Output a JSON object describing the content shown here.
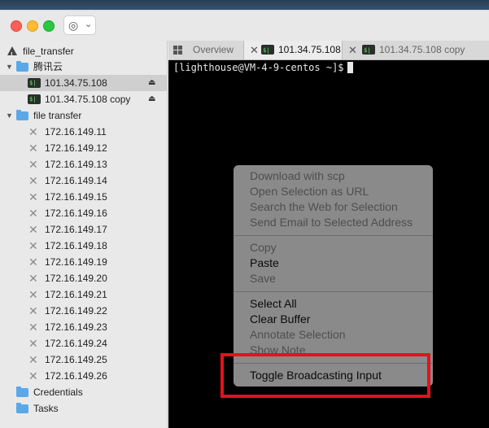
{
  "window": {
    "title_button_glyph": "◎",
    "title_button_chevron": "⌄"
  },
  "sidebar": {
    "root_label": "file_transfer",
    "groups": [
      {
        "label": "腾讯云",
        "hosts": [
          {
            "label": "101.34.75.108",
            "selected": true
          },
          {
            "label": "101.34.75.108 copy",
            "selected": false
          }
        ]
      },
      {
        "label": "file transfer",
        "hosts": [
          {
            "label": "172.16.149.11"
          },
          {
            "label": "172.16.149.12"
          },
          {
            "label": "172.16.149.13"
          },
          {
            "label": "172.16.149.14"
          },
          {
            "label": "172.16.149.15"
          },
          {
            "label": "172.16.149.16"
          },
          {
            "label": "172.16.149.17"
          },
          {
            "label": "172.16.149.18"
          },
          {
            "label": "172.16.149.19"
          },
          {
            "label": "172.16.149.20"
          },
          {
            "label": "172.16.149.21"
          },
          {
            "label": "172.16.149.22"
          },
          {
            "label": "172.16.149.23"
          },
          {
            "label": "172.16.149.24"
          },
          {
            "label": "172.16.149.25"
          },
          {
            "label": "172.16.149.26"
          }
        ]
      }
    ],
    "credentials_label": "Credentials",
    "tasks_label": "Tasks"
  },
  "tabs": [
    {
      "label": "Overview",
      "icon": "grid-icon",
      "active": false
    },
    {
      "label": "101.34.75.108",
      "icon": "terminal-icon",
      "active": true
    },
    {
      "label": "101.34.75.108 copy",
      "icon": "terminal-icon",
      "active": false
    }
  ],
  "terminal": {
    "prompt": "[lighthouse@VM-4-9-centos ~]$"
  },
  "context_menu": {
    "items": [
      {
        "label": "Download with scp",
        "enabled": false
      },
      {
        "label": "Open Selection as URL",
        "enabled": false
      },
      {
        "label": "Search the Web for Selection",
        "enabled": false
      },
      {
        "label": "Send Email to Selected Address",
        "enabled": false
      },
      {
        "label": "Copy",
        "enabled": false
      },
      {
        "label": "Paste",
        "enabled": true
      },
      {
        "label": "Save",
        "enabled": false
      },
      {
        "label": "Select All",
        "enabled": true
      },
      {
        "label": "Clear Buffer",
        "enabled": true
      },
      {
        "label": "Annotate Selection",
        "enabled": false
      },
      {
        "label": "Show Note",
        "enabled": false
      },
      {
        "label": "Toggle Broadcasting Input",
        "enabled": true
      }
    ]
  },
  "colors": {
    "highlight_box": "#e8101b",
    "terminal_bg": "#000000",
    "folder": "#5aa8e8"
  }
}
